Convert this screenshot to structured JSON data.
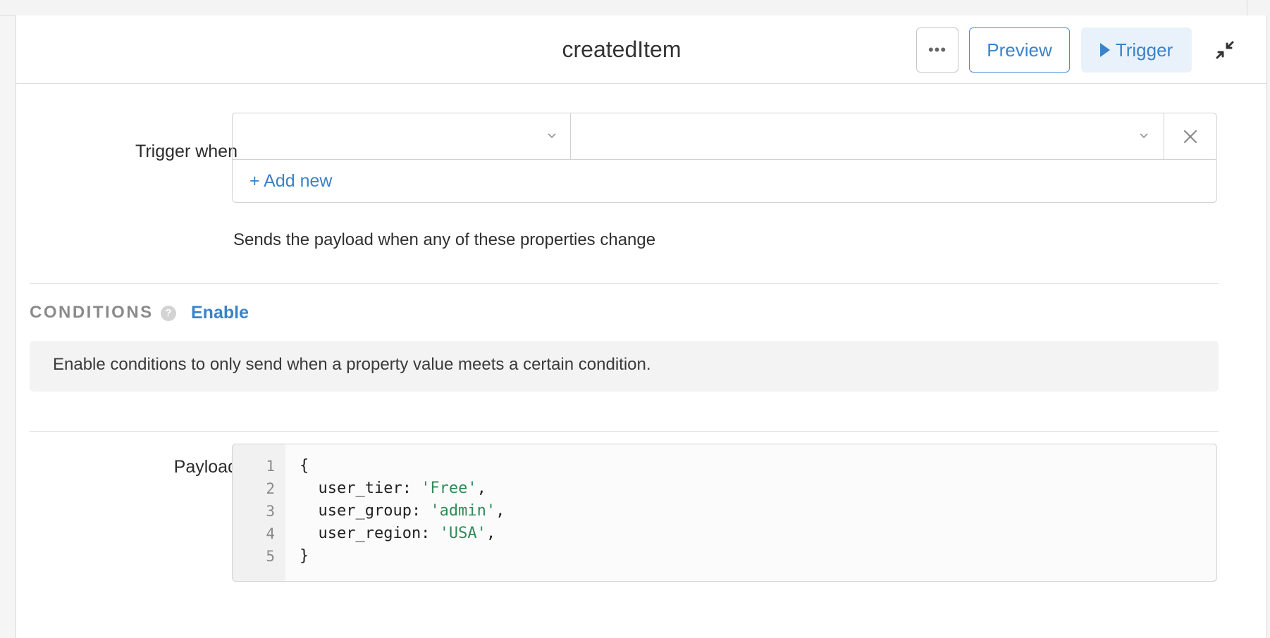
{
  "header": {
    "title": "createdItem",
    "more_label": "•••",
    "preview_label": "Preview",
    "trigger_label": "Trigger"
  },
  "trigger": {
    "label": "Trigger when",
    "select_1_value": "",
    "select_2_value": "",
    "add_new_label": "+ Add new",
    "help_text": "Sends the payload when any of these properties change"
  },
  "conditions": {
    "heading": "CONDITIONS",
    "help_icon": "?",
    "enable_label": "Enable",
    "description": "Enable conditions to only send when a property value meets a certain condition."
  },
  "payload": {
    "label": "Payload",
    "lines": [
      {
        "num": "1",
        "key": "",
        "value": "",
        "raw": "{"
      },
      {
        "num": "2",
        "key": "  user_tier: ",
        "value": "'Free'",
        "suffix": ","
      },
      {
        "num": "3",
        "key": "  user_group: ",
        "value": "'admin'",
        "suffix": ","
      },
      {
        "num": "4",
        "key": "  user_region: ",
        "value": "'USA'",
        "suffix": ","
      },
      {
        "num": "5",
        "key": "",
        "value": "",
        "raw": "}"
      }
    ]
  },
  "colors": {
    "accent": "#3b82c8",
    "string": "#2e8b57"
  },
  "icons": {
    "more": "ellipsis-icon",
    "trigger": "play-icon",
    "collapse": "collapse-arrows-icon",
    "chevron": "chevron-down-icon",
    "clear": "close-icon",
    "help": "question-circle-icon"
  }
}
